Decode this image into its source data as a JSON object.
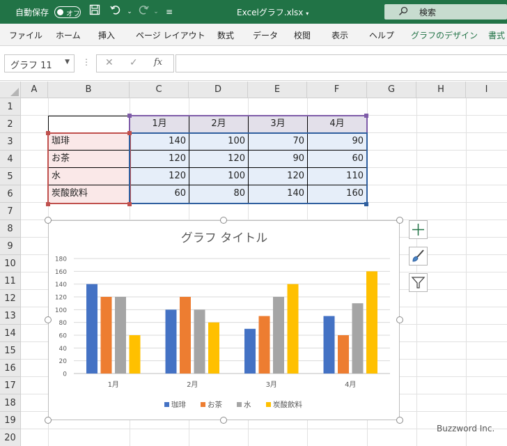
{
  "titlebar": {
    "autosave_label": "自動保存",
    "toggle_text": "オフ",
    "filename": "Excelグラフ.xlsx",
    "search_placeholder": "検索",
    "accent_color": "#217346"
  },
  "ribbon": {
    "tabs": [
      "ファイル",
      "ホーム",
      "挿入",
      "ページ レイアウト",
      "数式",
      "データ",
      "校閲",
      "表示",
      "ヘルプ",
      "グラフのデザイン",
      "書式"
    ]
  },
  "formula_bar": {
    "name_box": "グラフ 11",
    "fx": "fx",
    "value": ""
  },
  "sheet": {
    "columns": [
      "A",
      "B",
      "C",
      "D",
      "E",
      "F",
      "G",
      "H",
      "I"
    ],
    "rows": [
      "1",
      "2",
      "3",
      "4",
      "5",
      "6",
      "7",
      "8",
      "9",
      "10",
      "11",
      "12",
      "13",
      "14",
      "15",
      "16",
      "17",
      "18",
      "19",
      "20"
    ],
    "header_months": [
      "1月",
      "2月",
      "3月",
      "4月"
    ],
    "items": [
      {
        "name": "珈琲",
        "values": [
          "140",
          "100",
          "70",
          "90"
        ]
      },
      {
        "name": "お茶",
        "values": [
          "120",
          "120",
          "90",
          "60"
        ]
      },
      {
        "name": "水",
        "values": [
          "120",
          "100",
          "120",
          "110"
        ]
      },
      {
        "name": "炭酸飲料",
        "values": [
          "60",
          "80",
          "140",
          "160"
        ]
      }
    ]
  },
  "chart_data": {
    "type": "bar",
    "title": "グラフ タイトル",
    "categories": [
      "1月",
      "2月",
      "3月",
      "4月"
    ],
    "series": [
      {
        "name": "珈琲",
        "values": [
          140,
          100,
          70,
          90
        ],
        "color": "#4472c4"
      },
      {
        "name": "お茶",
        "values": [
          120,
          120,
          90,
          60
        ],
        "color": "#ed7d31"
      },
      {
        "name": "水",
        "values": [
          120,
          100,
          120,
          110
        ],
        "color": "#a5a5a5"
      },
      {
        "name": "炭酸飲料",
        "values": [
          60,
          80,
          140,
          160
        ],
        "color": "#ffc000"
      }
    ],
    "ylim": [
      0,
      180
    ],
    "yticks": [
      "0",
      "20",
      "40",
      "60",
      "80",
      "100",
      "120",
      "140",
      "160",
      "180"
    ],
    "grid": true,
    "legend": "bottom"
  },
  "watermark": "Buzzword Inc."
}
